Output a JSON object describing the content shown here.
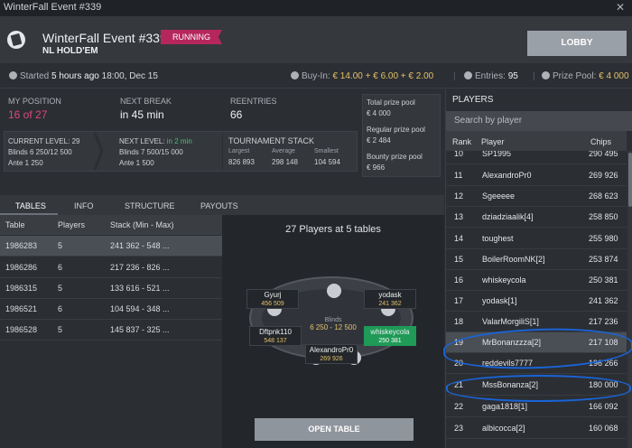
{
  "window": {
    "title": "WinterFall Event #339",
    "close": "✕"
  },
  "header": {
    "event_title": "WinterFall Event #339",
    "game_type": "NL HOLD'EM",
    "status": "RUNNING",
    "lobby_label": "LOBBY"
  },
  "info": {
    "started_label": "Started",
    "started_value": "5 hours ago",
    "started_time": "18:00, Dec 15",
    "buyin_label": "Buy-In:",
    "buyin_value": "€ 14.00 + € 6.00 + € 2.00",
    "entries_label": "Entries:",
    "entries_value": "95",
    "prize_label": "Prize Pool:",
    "prize_value": "€ 4 000"
  },
  "stats": {
    "my_position_label": "MY POSITION",
    "my_position_value": "16 of 27",
    "next_break_label": "NEXT BREAK",
    "next_break_value": "in 45 min",
    "reentries_label": "REENTRIES",
    "reentries_value": "66",
    "total_pool_label": "Total prize pool",
    "total_pool_value": "€ 4 000",
    "regular_pool_label": "Regular prize pool",
    "regular_pool_value": "€ 2 484",
    "bounty_pool_label": "Bounty prize pool",
    "bounty_pool_value": "€ 966",
    "current_level_label": "CURRENT LEVEL:",
    "current_level_value": "29",
    "current_blinds": "Blinds 6 250/12 500",
    "current_ante": "Ante 1 250",
    "next_level_label": "NEXT LEVEL:",
    "next_level_value": "in 2 min",
    "next_blinds": "Blinds 7 500/15 000",
    "next_ante": "Ante 1 500",
    "stack_label": "TOURNAMENT STACK",
    "stack_largest_label": "Largest",
    "stack_largest": "826 893",
    "stack_average_label": "Average",
    "stack_average": "298 148",
    "stack_smallest_label": "Smallest",
    "stack_smallest": "104 594"
  },
  "tabs": [
    "TABLES",
    "INFO",
    "STRUCTURE",
    "PAYOUTS"
  ],
  "tables": {
    "columns": [
      "Table",
      "Players",
      "Stack (Min - Max)"
    ],
    "rows": [
      {
        "table": "1986283",
        "players": "5",
        "stack": "241 362 - 548 ..."
      },
      {
        "table": "1986286",
        "players": "6",
        "stack": "217 236 - 826 ..."
      },
      {
        "table": "1986315",
        "players": "5",
        "stack": "133 616 - 521 ..."
      },
      {
        "table": "1986521",
        "players": "6",
        "stack": "104 594 - 348 ..."
      },
      {
        "table": "1986528",
        "players": "5",
        "stack": "145 837 - 325 ..."
      }
    ]
  },
  "preview": {
    "title": "27 Players at 5 tables",
    "blinds_label": "Blinds",
    "blinds_value": "6 250 - 12 500",
    "seats": [
      {
        "name": "Gyurj",
        "chips": "456 509"
      },
      {
        "name": "yodask",
        "chips": "241 362"
      },
      {
        "name": "Dftpnk110",
        "chips": "548 137"
      },
      {
        "name": "whiskeycola",
        "chips": "250 381"
      },
      {
        "name": "AlexandroPr0",
        "chips": "269 926"
      }
    ],
    "open_label": "OPEN TABLE"
  },
  "players": {
    "title": "PLAYERS",
    "search_placeholder": "Search by player",
    "columns": [
      "Rank",
      "Player",
      "Chips"
    ],
    "rows": [
      {
        "rank": "10",
        "name": "SP1995",
        "chips": "290 495"
      },
      {
        "rank": "11",
        "name": "AlexandroPr0",
        "chips": "269 926"
      },
      {
        "rank": "12",
        "name": "Sgeeeee",
        "chips": "268 623"
      },
      {
        "rank": "13",
        "name": "dziadziaalik[4]",
        "chips": "258 850"
      },
      {
        "rank": "14",
        "name": "toughest",
        "chips": "255 980"
      },
      {
        "rank": "15",
        "name": "BoilerRoomNK[2]",
        "chips": "253 874"
      },
      {
        "rank": "16",
        "name": "whiskeycola",
        "chips": "250 381"
      },
      {
        "rank": "17",
        "name": "yodask[1]",
        "chips": "241 362"
      },
      {
        "rank": "18",
        "name": "ValarMorgiliS[1]",
        "chips": "217 236"
      },
      {
        "rank": "19",
        "name": "MrBonanzzza[2]",
        "chips": "217 108"
      },
      {
        "rank": "20",
        "name": "reddevils7777",
        "chips": "196 266"
      },
      {
        "rank": "21",
        "name": "MssBonanza[2]",
        "chips": "180 000"
      },
      {
        "rank": "22",
        "name": "gaga1818[1]",
        "chips": "166 092"
      },
      {
        "rank": "23",
        "name": "albicocca[2]",
        "chips": "160 068"
      }
    ]
  },
  "colors": {
    "accent_pink": "#e0467c",
    "gold": "#e3c06a",
    "green": "#47c07a",
    "annotation_blue": "#1a64d6"
  }
}
